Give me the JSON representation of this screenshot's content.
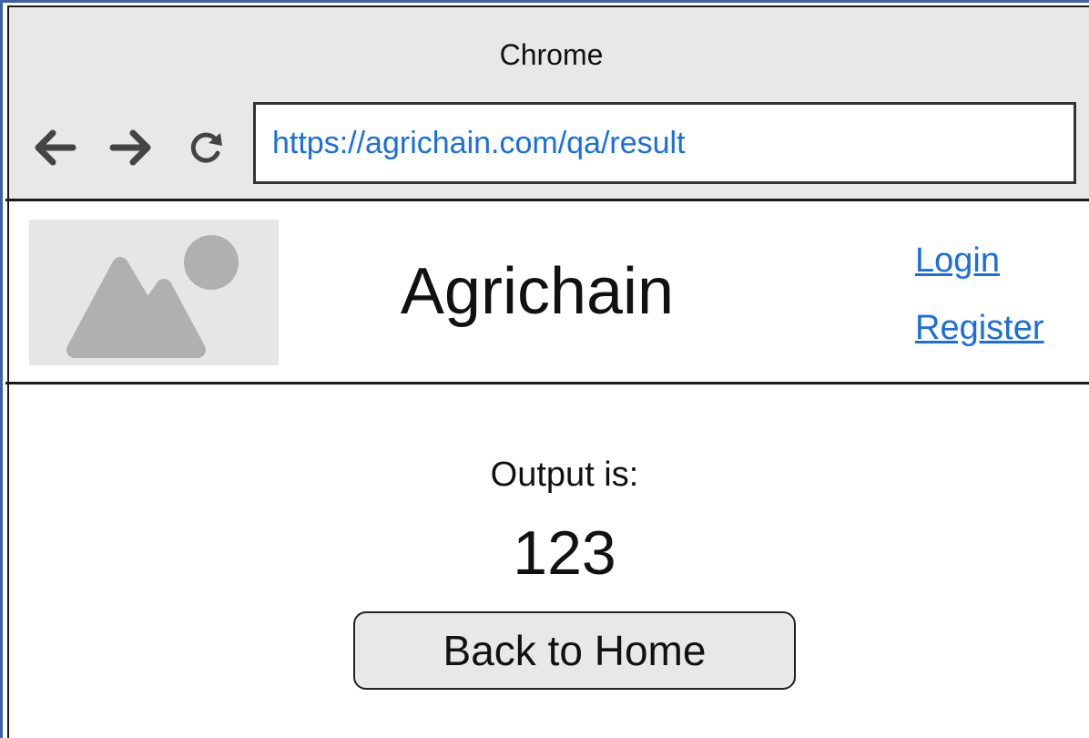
{
  "browser": {
    "window_title": "Chrome",
    "url": "https://agrichain.com/qa/result",
    "nav_icons": [
      "back-arrow-icon",
      "forward-arrow-icon",
      "reload-icon"
    ]
  },
  "header": {
    "logo_icon": "image-placeholder-icon",
    "site_title": "Agrichain",
    "login_label": "Login",
    "register_label": "Register"
  },
  "result": {
    "label": "Output is:",
    "value": "123",
    "back_button_label": "Back to Home"
  },
  "colors": {
    "link": "#1a6ee0",
    "chrome_background": "#e8e8e8",
    "button_background": "#e8e8e8",
    "placeholder_background": "#e6e6e6",
    "placeholder_shape": "#b0b0b0",
    "window_border": "#3c5fa8"
  }
}
